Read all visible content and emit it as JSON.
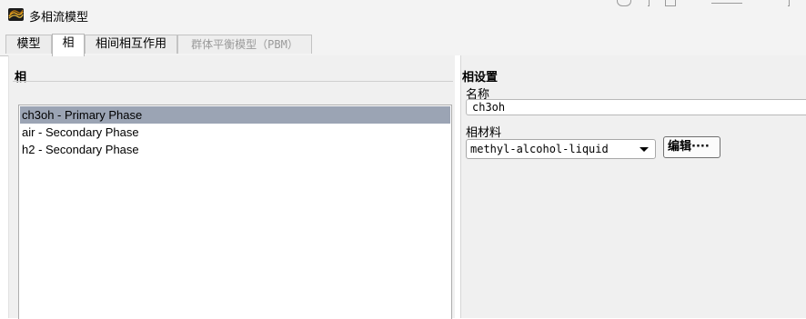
{
  "window": {
    "title": "多相流模型",
    "icon": "fluent-app-icon"
  },
  "tabs": [
    {
      "label": "模型",
      "active": false,
      "disabled": false
    },
    {
      "label": "相",
      "active": true,
      "disabled": false
    },
    {
      "label": "相间相互作用",
      "active": false,
      "disabled": false
    },
    {
      "label": "群体平衡模型（PBM）",
      "active": false,
      "disabled": true
    }
  ],
  "phases": {
    "section_title": "相",
    "items": [
      {
        "label": "ch3oh - Primary Phase",
        "selected": true
      },
      {
        "label": "air - Secondary Phase",
        "selected": false
      },
      {
        "label": "h2 - Secondary Phase",
        "selected": false
      }
    ]
  },
  "phase_settings": {
    "section_title": "相设置",
    "name_label": "名称",
    "name_value": "ch3oh",
    "material_label": "相材料",
    "material_value": "methyl-alcohol-liquid",
    "edit_button": "编辑····"
  },
  "colors": {
    "selection": "#9ba4b4",
    "panel_bg": "#f0f0f0",
    "titlebar_bg": "#f3f3f3"
  }
}
